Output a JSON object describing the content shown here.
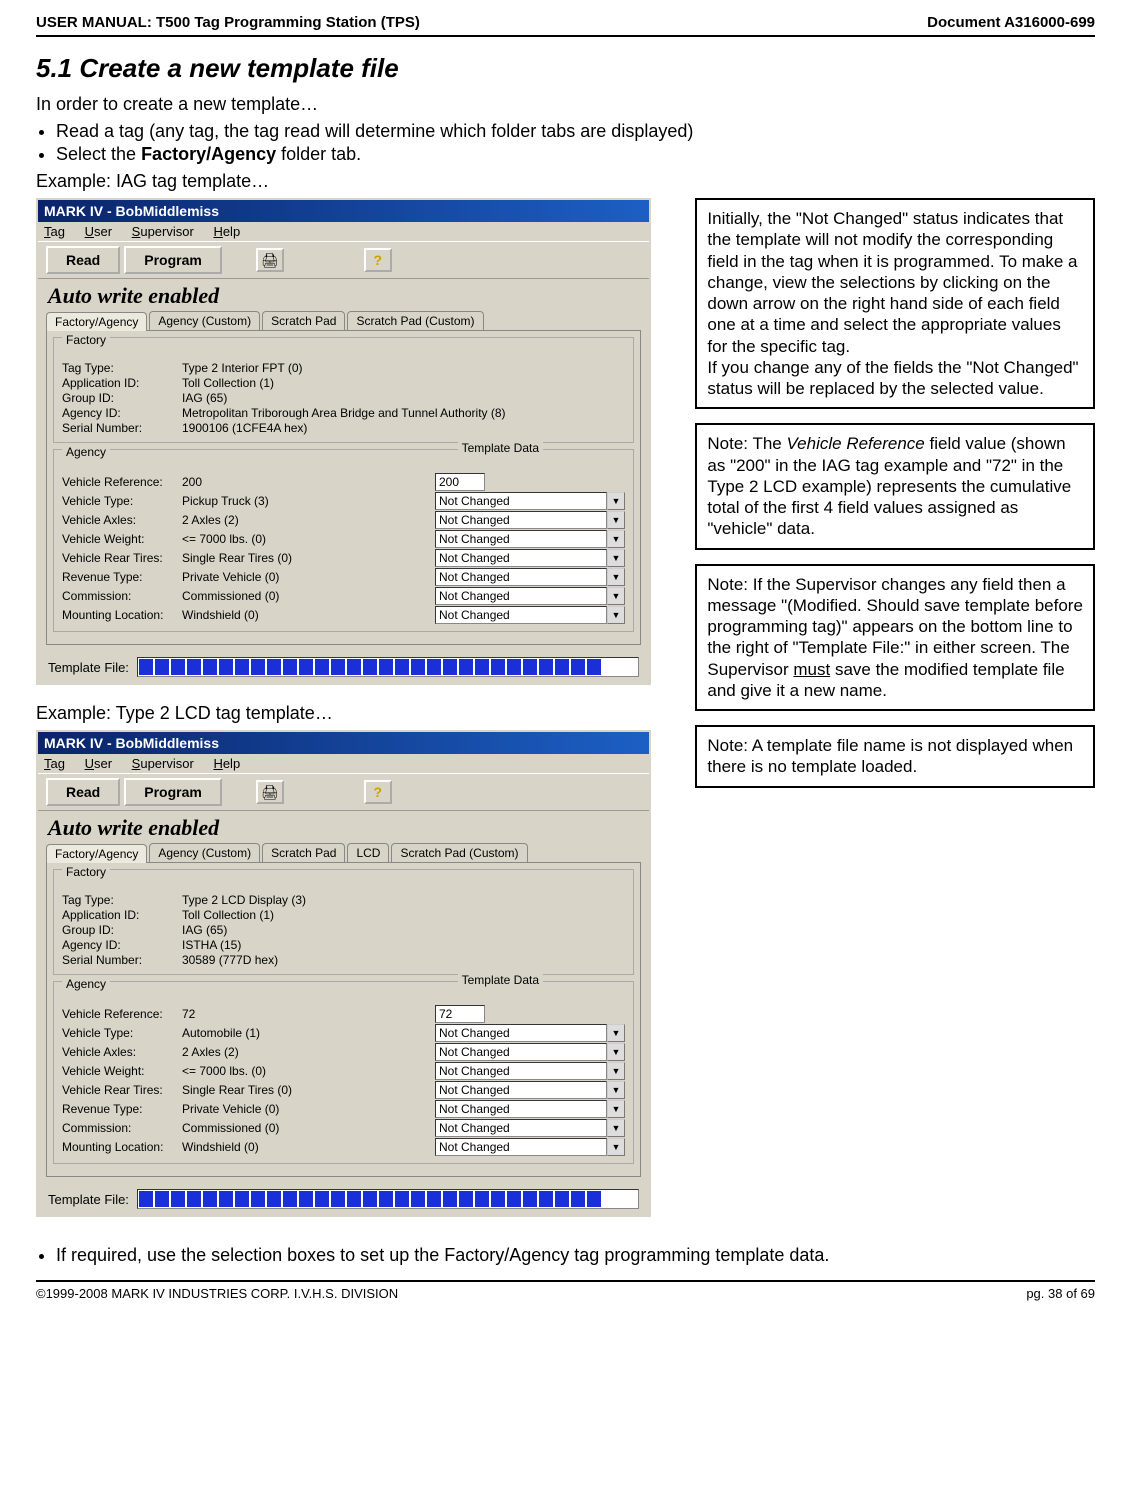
{
  "header": {
    "left": "USER MANUAL: T500 Tag Programming Station (TPS)",
    "right": "Document A316000-699"
  },
  "section_title": "5.1 Create a new template file",
  "intro": "In order to create a new template…",
  "bullets": {
    "b1_pre": "Read a tag (any tag, the tag read will determine which folder tabs are displayed)",
    "b2_pre": "Select the ",
    "b2_bold": "Factory/Agency",
    "b2_post": " folder tab."
  },
  "example1_caption": "Example: IAG tag template…",
  "example2_caption": "Example: Type 2 LCD tag template…",
  "bullet_bottom": "If required, use the selection boxes to set up the Factory/Agency tag programming template data.",
  "footer": {
    "left": "©1999-2008 MARK IV INDUSTRIES CORP. I.V.H.S. DIVISION",
    "right": "pg. 38 of 69"
  },
  "app": {
    "title": "MARK IV - BobMiddlemiss",
    "menu": {
      "tag": "Tag",
      "user": "User",
      "supervisor": "Supervisor",
      "help": "Help"
    },
    "buttons": {
      "read": "Read",
      "program": "Program"
    },
    "autowrite": "Auto write enabled",
    "tabs1": [
      "Factory/Agency",
      "Agency (Custom)",
      "Scratch Pad",
      "Scratch Pad (Custom)"
    ],
    "tabs2": [
      "Factory/Agency",
      "Agency (Custom)",
      "Scratch Pad",
      "LCD",
      "Scratch Pad (Custom)"
    ],
    "factory_legend": "Factory",
    "agency_legend": "Agency",
    "tdata_legend": "Template Data",
    "tf_label": "Template File:",
    "notchanged": "Not Changed"
  },
  "ex1": {
    "factory": {
      "tag_type": {
        "l": "Tag Type:",
        "v": "Type 2 Interior FPT (0)"
      },
      "app_id": {
        "l": "Application ID:",
        "v": "Toll Collection (1)"
      },
      "group_id": {
        "l": "Group ID:",
        "v": "IAG (65)"
      },
      "agency_id": {
        "l": "Agency ID:",
        "v": "Metropolitan Triborough Area Bridge and Tunnel Authority (8)"
      },
      "serial": {
        "l": "Serial Number:",
        "v": "1900106 (1CFE4A hex)"
      }
    },
    "agency": {
      "vref": {
        "l": "Vehicle Reference:",
        "v": "200",
        "td": "200"
      },
      "vtype": {
        "l": "Vehicle Type:",
        "v": "Pickup Truck (3)"
      },
      "vaxles": {
        "l": "Vehicle Axles:",
        "v": "2 Axles (2)"
      },
      "vweight": {
        "l": "Vehicle Weight:",
        "v": "<= 7000 lbs. (0)"
      },
      "vrear": {
        "l": "Vehicle Rear Tires:",
        "v": "Single Rear Tires (0)"
      },
      "rev": {
        "l": "Revenue Type:",
        "v": "Private Vehicle (0)"
      },
      "comm": {
        "l": "Commission:",
        "v": "Commissioned (0)"
      },
      "mount": {
        "l": "Mounting Location:",
        "v": "Windshield (0)"
      }
    }
  },
  "ex2": {
    "factory": {
      "tag_type": {
        "l": "Tag Type:",
        "v": "Type 2 LCD Display (3)"
      },
      "app_id": {
        "l": "Application ID:",
        "v": "Toll Collection (1)"
      },
      "group_id": {
        "l": "Group ID:",
        "v": "IAG (65)"
      },
      "agency_id": {
        "l": "Agency ID:",
        "v": "ISTHA (15)"
      },
      "serial": {
        "l": "Serial Number:",
        "v": "30589 (777D hex)"
      }
    },
    "agency": {
      "vref": {
        "l": "Vehicle Reference:",
        "v": "72",
        "td": "72"
      },
      "vtype": {
        "l": "Vehicle Type:",
        "v": "Automobile (1)"
      },
      "vaxles": {
        "l": "Vehicle Axles:",
        "v": "2 Axles (2)"
      },
      "vweight": {
        "l": "Vehicle Weight:",
        "v": "<= 7000 lbs. (0)"
      },
      "vrear": {
        "l": "Vehicle Rear Tires:",
        "v": "Single Rear Tires (0)"
      },
      "rev": {
        "l": "Revenue Type:",
        "v": "Private Vehicle (0)"
      },
      "comm": {
        "l": "Commission:",
        "v": "Commissioned (0)"
      },
      "mount": {
        "l": "Mounting Location:",
        "v": "Windshield (0)"
      }
    }
  },
  "notes": {
    "n1": "Initially, the \"Not Changed\" status indicates that the template will not modify the corresponding field in the tag when it is programmed. To make a change, view the selections by clicking on the down arrow  on the right hand side of each field one at a time and select the appropriate values for the specific tag.\nIf you change any of the fields the \"Not Changed\" status will be replaced by the selected value.",
    "n2_pre": "Note: The ",
    "n2_it": "Vehicle Reference",
    "n2_post": " field value (shown as \"200\" in the IAG tag example and \"72\" in the Type 2 LCD example) represents the cumulative total of the first 4 field values assigned as \"vehicle\" data.",
    "n3_pre": "Note: If the Supervisor changes any field then a message \"(Modified. Should save template before programming tag)\" appears on the bottom line to the right of \"Template File:\" in either screen. The Supervisor ",
    "n3_ul": "must",
    "n3_post": " save the modified template file and give it a new name.",
    "n4": "Note: A template file name is not displayed when there is no template loaded."
  }
}
